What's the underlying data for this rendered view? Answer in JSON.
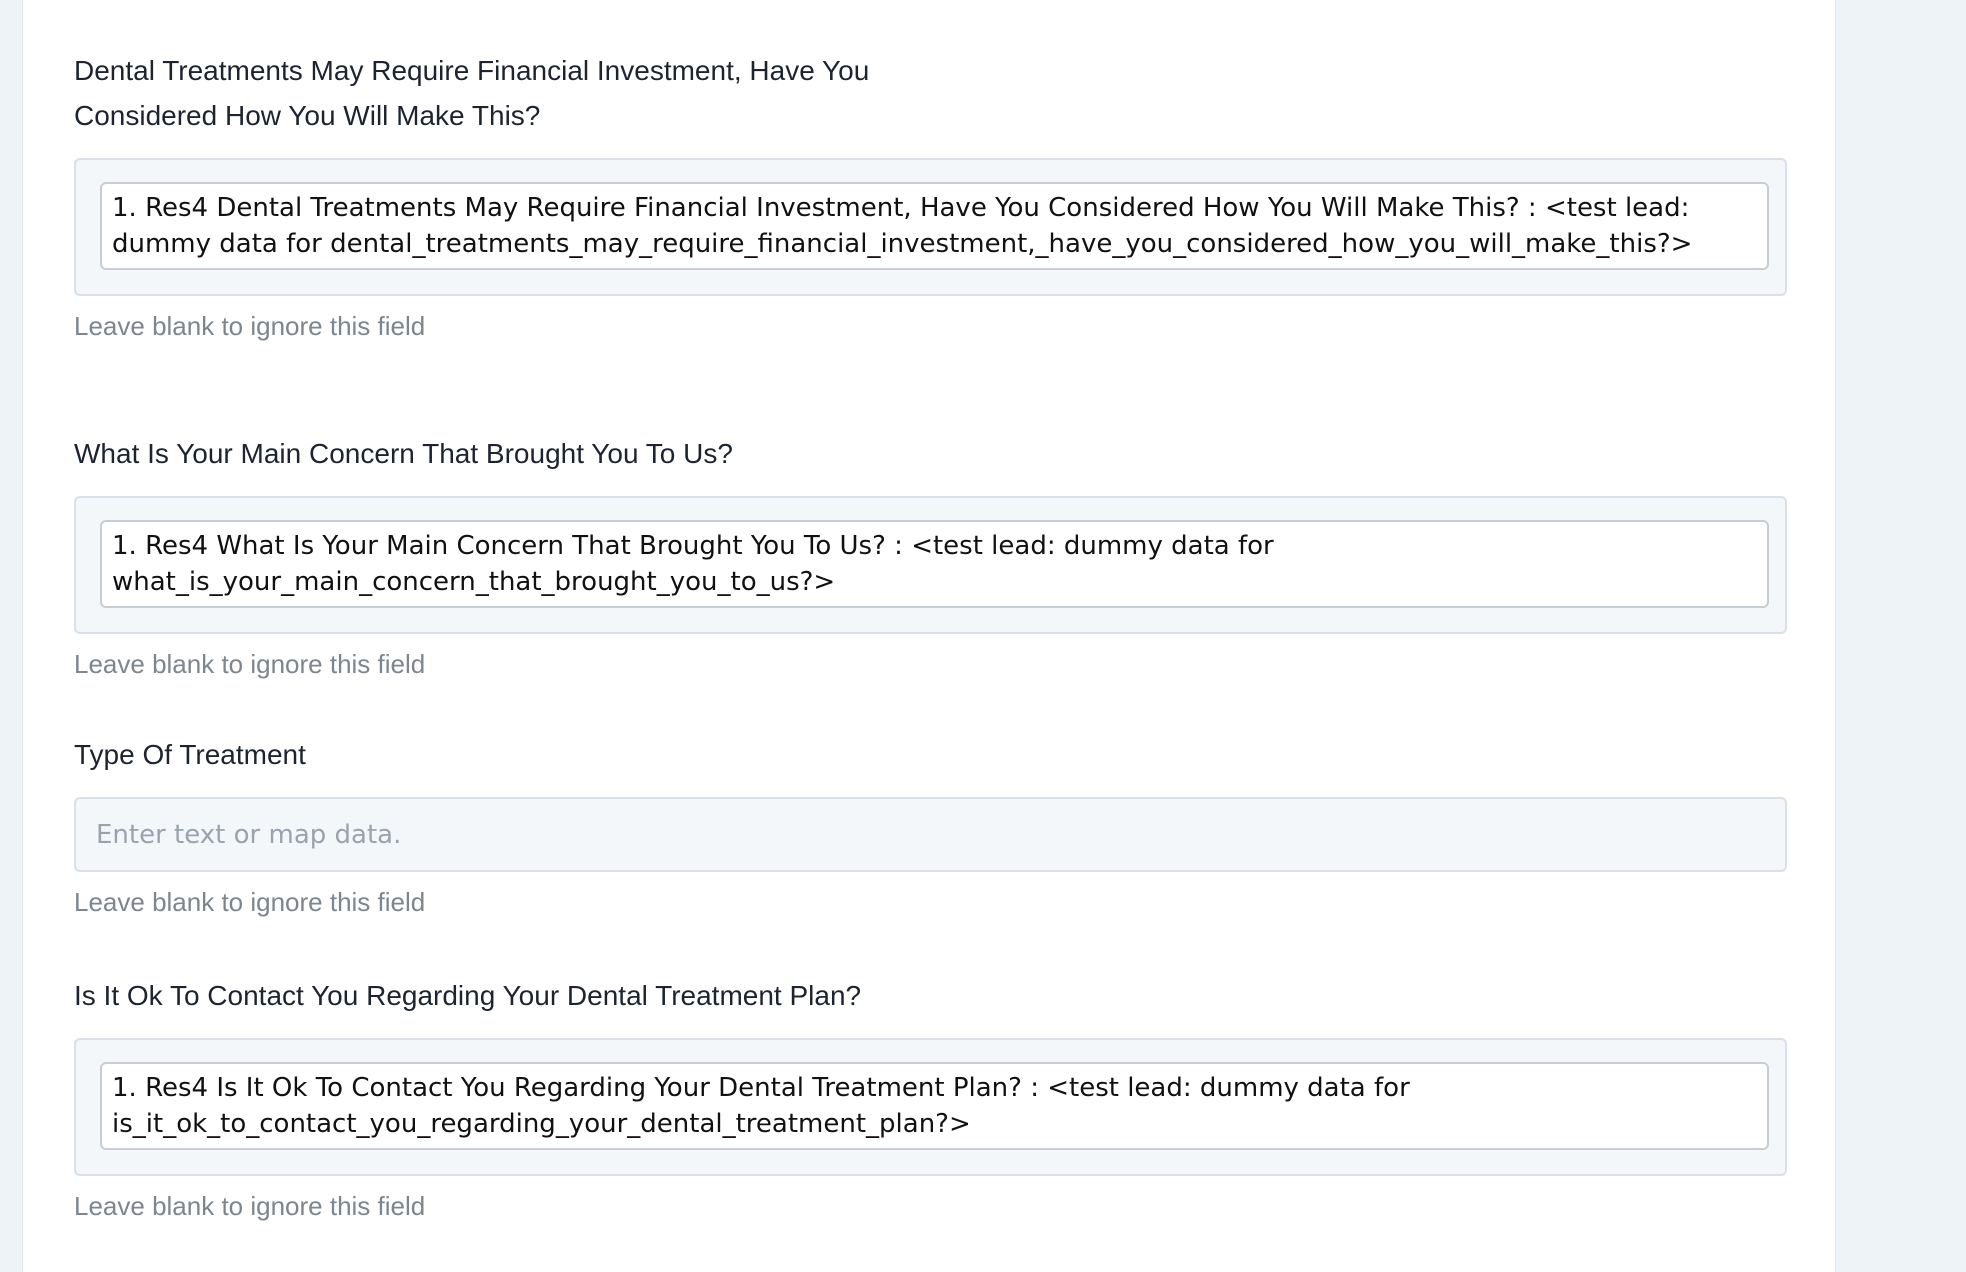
{
  "fields": [
    {
      "label": "Dental Treatments May Require Financial Investment, Have You Considered How You Will Make This?",
      "value": "1. Res4 Dental Treatments May Require Financial Investment, Have You Considered How You Will Make This? : <test lead: dummy data for dental_treatments_may_require_financial_investment,_have_you_considered_how_you_will_make_this?>",
      "hint": "Leave blank to ignore this field"
    },
    {
      "label": "What Is Your Main Concern That Brought You To Us?",
      "value": "1. Res4 What Is Your Main Concern That Brought You To Us? : <test lead: dummy data for what_is_your_main_concern_that_brought_you_to_us?>",
      "hint": "Leave blank to ignore this field"
    },
    {
      "label": "Type Of Treatment",
      "placeholder": "Enter text or map data.",
      "hint": "Leave blank to ignore this field"
    },
    {
      "label": "Is It Ok To Contact You Regarding Your Dental Treatment Plan?",
      "value": "1. Res4 Is It Ok To Contact You Regarding Your Dental Treatment Plan? : <test lead: dummy data for is_it_ok_to_contact_you_regarding_your_dental_treatment_plan?>",
      "hint": "Leave blank to ignore this field"
    }
  ]
}
